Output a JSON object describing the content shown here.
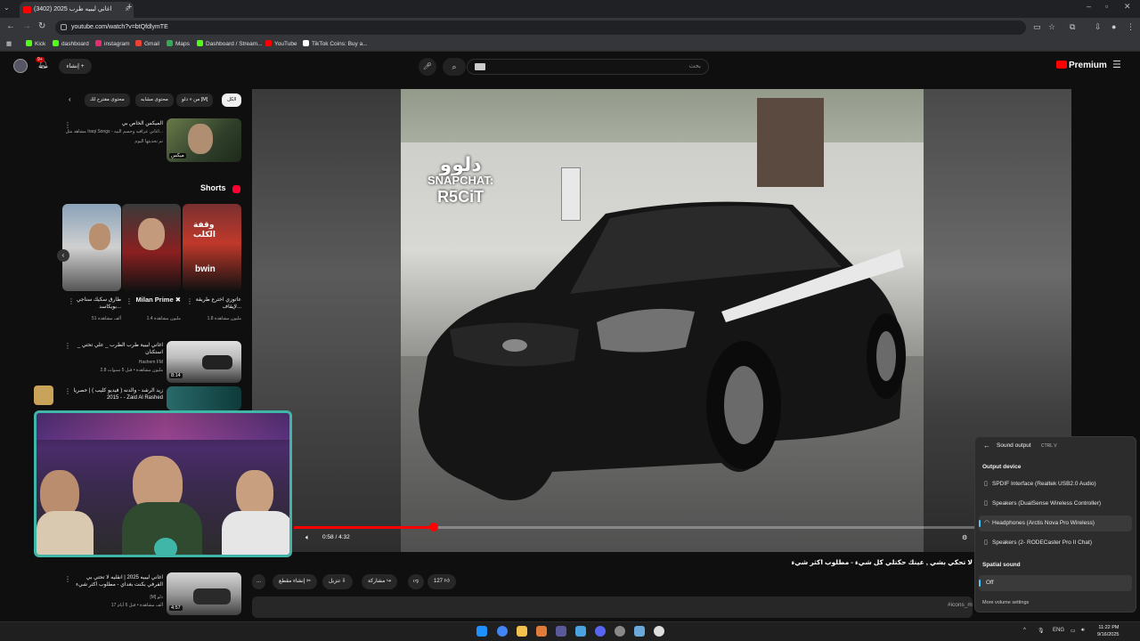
{
  "browser": {
    "tab_title": "(3402) اغاني ليبيه طرب 2025",
    "url": "youtube.com/watch?v=btQfdlymTE",
    "bookmarks": [
      "Kick",
      "dashboard",
      "instagram",
      "Gmail",
      "Maps",
      "Dashboard / Stream...",
      "YouTube",
      "TikTok Coins: Buy a..."
    ]
  },
  "yt_header": {
    "search_placeholder": "بحث",
    "create_label": "إنشاء",
    "notif_count": "9+",
    "logo": "Premium"
  },
  "chips": [
    "الكل",
    "من « دلو [M]",
    "محتوى مشابه",
    "محتوى مقترح لك"
  ],
  "sidebar": {
    "mix": {
      "title": "الميكس الخاص بي",
      "meta1": "مشاهد مثل Iraqi Songs - اغاني عراقيه وحسم البيه...",
      "meta2": "تم تحديثها اليوم",
      "badge": "ميكس"
    },
    "shorts_title": "Shorts",
    "shorts": [
      {
        "title": "عاتوزي اخترع طريقة لإيقاف...",
        "views": "1.8 مليون مشاهدة"
      },
      {
        "title": "Milan Prime ✖",
        "views": "1.4 مليون مشاهدة"
      },
      {
        "title": "طارق سكيك سناجي بويكاسد...",
        "views": "51 ألف مشاهدة"
      }
    ],
    "videos": [
      {
        "title": "اغاني ليبية طرب الطرب _ علي تحتي _ استكنان",
        "channel": "Hashem FM",
        "meta": "2.8 مليون مشاهدة • قبل 5 سنوات",
        "dur": "8:14"
      },
      {
        "title": "زيد الرشد - والدنه ( فيديو كليب ) | حصريا 2015 - - Zaid Al Rashed",
        "channel": "",
        "meta": "",
        "dur": "4:06"
      },
      {
        "title": "اغاني ليبيه 2025 | انقليه لا تحتي بي الفرفي بكنت بغداي - مطلوب اكثر شيء",
        "channel": "[M] دلو",
        "meta": "17 ألف مشاهدة • قبل 6 أيام",
        "dur": "4:57"
      }
    ]
  },
  "player": {
    "overlay_line1": "دلوو",
    "overlay_line2": "SNAPCHAT:",
    "overlay_line3": "R5CiT",
    "time": "0:58 / 4:32",
    "progress_fraction": 0.18
  },
  "video": {
    "title": "لا تحكي بشي , عينك حكتلي كل شيء - مطلوب اكثر شيء",
    "likes": "127",
    "share": "مشاركة",
    "download": "تنزيل",
    "clip": "إنشاء مقطع",
    "more": "...",
    "hashtag": "#icons_m"
  },
  "sound_panel": {
    "header": "Sound output",
    "shortcut": "CTRL  V",
    "section_output": "Output device",
    "devices": [
      "SPDIF Interface (Realtek USB2.0 Audio)",
      "Speakers (DualSense Wireless Controller)",
      "Headphones (Arctis Nova Pro Wireless)",
      "Speakers (2- RODECaster Pro II Chat)"
    ],
    "selected_device_index": 2,
    "section_spatial": "Spatial sound",
    "spatial_value": "Off",
    "more": "More volume settings"
  },
  "taskbar": {
    "lang": "ENG",
    "time": "11:22 PM",
    "date": "9/16/2025"
  },
  "colors": {
    "accent": "#ff0000",
    "webcam_border": "#3fb6a8",
    "win_accent": "#4cc2ff"
  }
}
